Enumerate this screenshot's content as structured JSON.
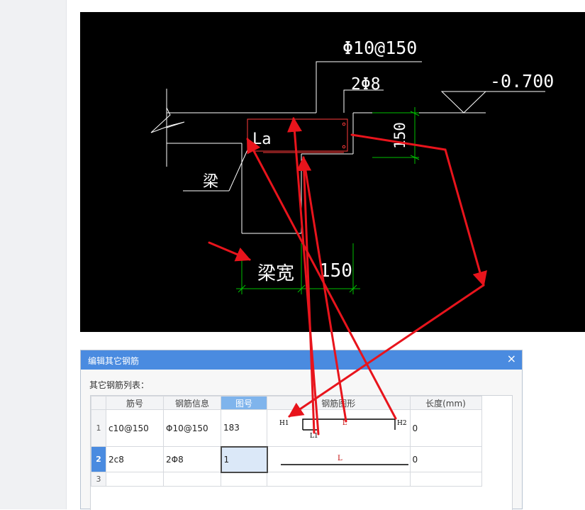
{
  "cad": {
    "spec_stirrup": "Φ10@150",
    "spec_bars": "2Φ8",
    "elevation": "-0.700",
    "label_la": "La",
    "label_dim_150_vertical": "150",
    "label_beam": "梁",
    "label_beam_width": "梁宽",
    "label_dim_150_horizontal": "150"
  },
  "dialog": {
    "title": "编辑其它钢筋",
    "close_glyph": "×",
    "list_label": "其它钢筋列表：",
    "columns": [
      "筋号",
      "钢筋信息",
      "图号",
      "钢筋图形",
      "长度(mm)"
    ],
    "active_column": "图号",
    "rows": [
      {
        "index": "1",
        "bar_no": "c10@150",
        "bar_info": "Φ10@150",
        "figure_no": "183",
        "shape_labels": {
          "h1": "H1",
          "l": "L",
          "h2": "H2",
          "l1": "L1"
        },
        "length": "0"
      },
      {
        "index": "2",
        "bar_no": "2c8",
        "bar_info": "2Φ8",
        "figure_no": "1",
        "shape_labels": {
          "l": "L"
        },
        "length": "0"
      },
      {
        "index": "3",
        "bar_no": "",
        "bar_info": "",
        "figure_no": "",
        "length": ""
      }
    ]
  },
  "colors": {
    "cad_background": "#000000",
    "cad_line": "#ffffff",
    "cad_dimension": "#00c000",
    "annotation_arrow": "#e8141c",
    "titlebar": "#4a8be0",
    "selected_cell": "#dbe8f8"
  }
}
